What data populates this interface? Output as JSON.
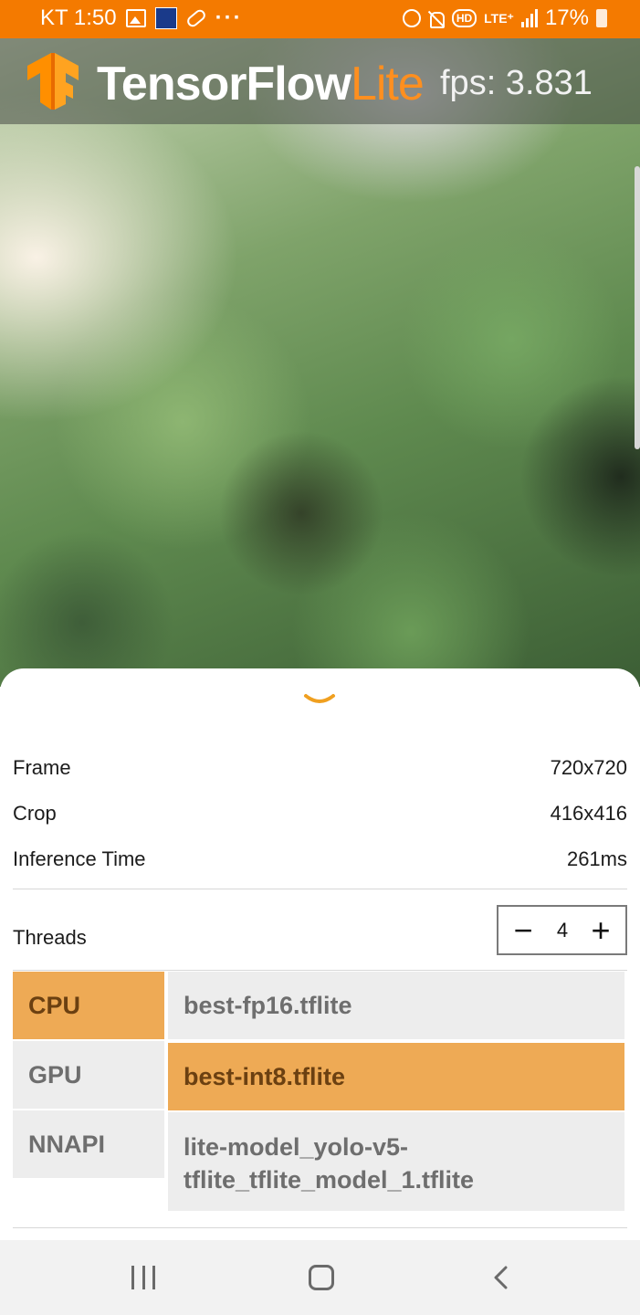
{
  "status_bar": {
    "carrier": "KT",
    "time": "1:50",
    "left_icons": [
      "image-icon",
      "app-notification-icon",
      "pill-icon",
      "more-notifications-icon"
    ],
    "more_indicator": "···",
    "right_icons": [
      "alarm-icon",
      "mute-icon",
      "hd-icon",
      "lte-icon",
      "signal-icon",
      "battery-icon"
    ],
    "hd_label": "HD",
    "network": "LTE⁺",
    "battery": "17%"
  },
  "header": {
    "brand_primary": "TensorFlow",
    "brand_secondary": "Lite",
    "fps_text": "fps: 3.831",
    "colors": {
      "brand_orange": "#ff8f1f",
      "status_orange": "#f47a00"
    }
  },
  "info": {
    "frame_label": "Frame",
    "frame_value": "720x720",
    "crop_label": "Crop",
    "crop_value": "416x416",
    "inference_label": "Inference Time",
    "inference_value": "261ms"
  },
  "threads": {
    "label": "Threads",
    "minus": "−",
    "value": "4",
    "plus": "+"
  },
  "devices": [
    {
      "label": "CPU",
      "selected": true
    },
    {
      "label": "GPU",
      "selected": false
    },
    {
      "label": "NNAPI",
      "selected": false
    }
  ],
  "models": [
    {
      "label": "best-fp16.tflite",
      "selected": false
    },
    {
      "label": "best-int8.tflite",
      "selected": true
    },
    {
      "label": "lite-model_yolo-v5-tflite_tflite_model_1.tflite",
      "selected": false
    }
  ],
  "models_display": {
    "line1_part1": "lite-model_yolo-v5-",
    "line1_part2": "tflite_tflite_model_1.tflite"
  },
  "nav": {
    "recent_icon": "recent-apps-icon",
    "home_icon": "home-icon",
    "back_icon": "back-icon"
  }
}
